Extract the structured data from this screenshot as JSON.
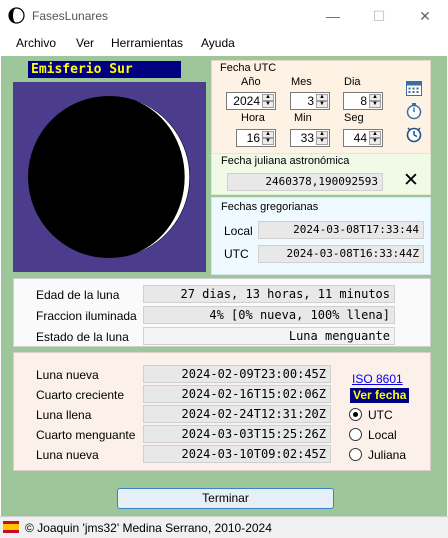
{
  "window": {
    "title": "FasesLunares",
    "minimize_glyph": "—",
    "maximize_glyph": "☐",
    "close_glyph": "✕"
  },
  "menu": [
    "Archivo",
    "Ver",
    "Herramientas",
    "Ayuda"
  ],
  "hemisphere": "Emisferio Sur",
  "utc": {
    "title": "Fecha UTC",
    "labels": {
      "year": "Año",
      "month": "Mes",
      "day": "Dia",
      "hour": "Hora",
      "minute": "Min",
      "second": "Seg"
    },
    "values": {
      "year": "2024",
      "month": "3",
      "day": "8",
      "hour": "16",
      "minute": "33",
      "second": "44"
    }
  },
  "julian": {
    "title": "Fecha juliana astronómica",
    "value": "2460378,190092593",
    "clear_glyph": "✕"
  },
  "gregorian": {
    "title": "Fechas gregorianas",
    "local_label": "Local",
    "local_value": "2024-03-08T17:33:44",
    "utc_label": "UTC",
    "utc_value": "2024-03-08T16:33:44Z"
  },
  "info": {
    "age_label": "Edad de la luna",
    "age_value": "27 dias, 13 horas, 11 minutos",
    "illum_label": "Fraccion iluminada",
    "illum_value": "4% [0% nueva, 100% llena]",
    "state_label": "Estado de la luna",
    "state_value": "Luna menguante"
  },
  "phases": [
    {
      "label": "Luna nueva",
      "value": "2024-02-09T23:00:45Z"
    },
    {
      "label": "Cuarto creciente",
      "value": "2024-02-16T15:02:06Z"
    },
    {
      "label": "Luna llena",
      "value": "2024-02-24T12:31:20Z"
    },
    {
      "label": "Cuarto menguante",
      "value": "2024-03-03T15:25:26Z"
    },
    {
      "label": "Luna nueva",
      "value": "2024-03-10T09:02:45Z"
    }
  ],
  "view": {
    "iso_link": "ISO 8601",
    "ver_fecha": "Ver fecha",
    "options": [
      "UTC",
      "Local",
      "Juliana"
    ],
    "selected": "UTC"
  },
  "buttons": {
    "close": "Terminar"
  },
  "status": {
    "text": "© Joaquin 'jms32' Medina Serrano, 2010-2024"
  },
  "moon": {
    "illuminated_fraction": 0.04,
    "lit_color": "#ffffff",
    "dark_color": "#000000",
    "sky_color": "#4b3c8e"
  },
  "colors": {
    "window_bg": "#9dc69b",
    "accent": "#000080",
    "accent_text": "#ffff00"
  }
}
